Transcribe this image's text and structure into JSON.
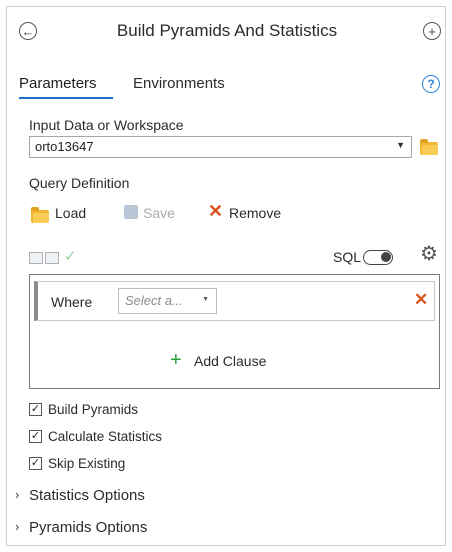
{
  "header": {
    "title": "Build Pyramids And Statistics"
  },
  "tabs": [
    {
      "label": "Parameters"
    },
    {
      "label": "Environments"
    }
  ],
  "input_data": {
    "label": "Input Data or Workspace",
    "value": "orto13647"
  },
  "query": {
    "label": "Query Definition",
    "load_label": "Load",
    "save_label": "Save",
    "remove_label": "Remove",
    "sql_label": "SQL",
    "where_label": "Where",
    "select_placeholder": "Select a...",
    "add_clause_label": "Add Clause"
  },
  "options": [
    {
      "label": "Build Pyramids",
      "checked": true
    },
    {
      "label": "Calculate Statistics",
      "checked": true
    },
    {
      "label": "Skip Existing",
      "checked": true
    }
  ],
  "sections": [
    {
      "label": "Statistics Options"
    },
    {
      "label": "Pyramids Options"
    }
  ],
  "colors": {
    "accent": "#1e73c7",
    "folder": "#f2b632",
    "remove": "#d9531e",
    "add": "#2e9e3e"
  }
}
